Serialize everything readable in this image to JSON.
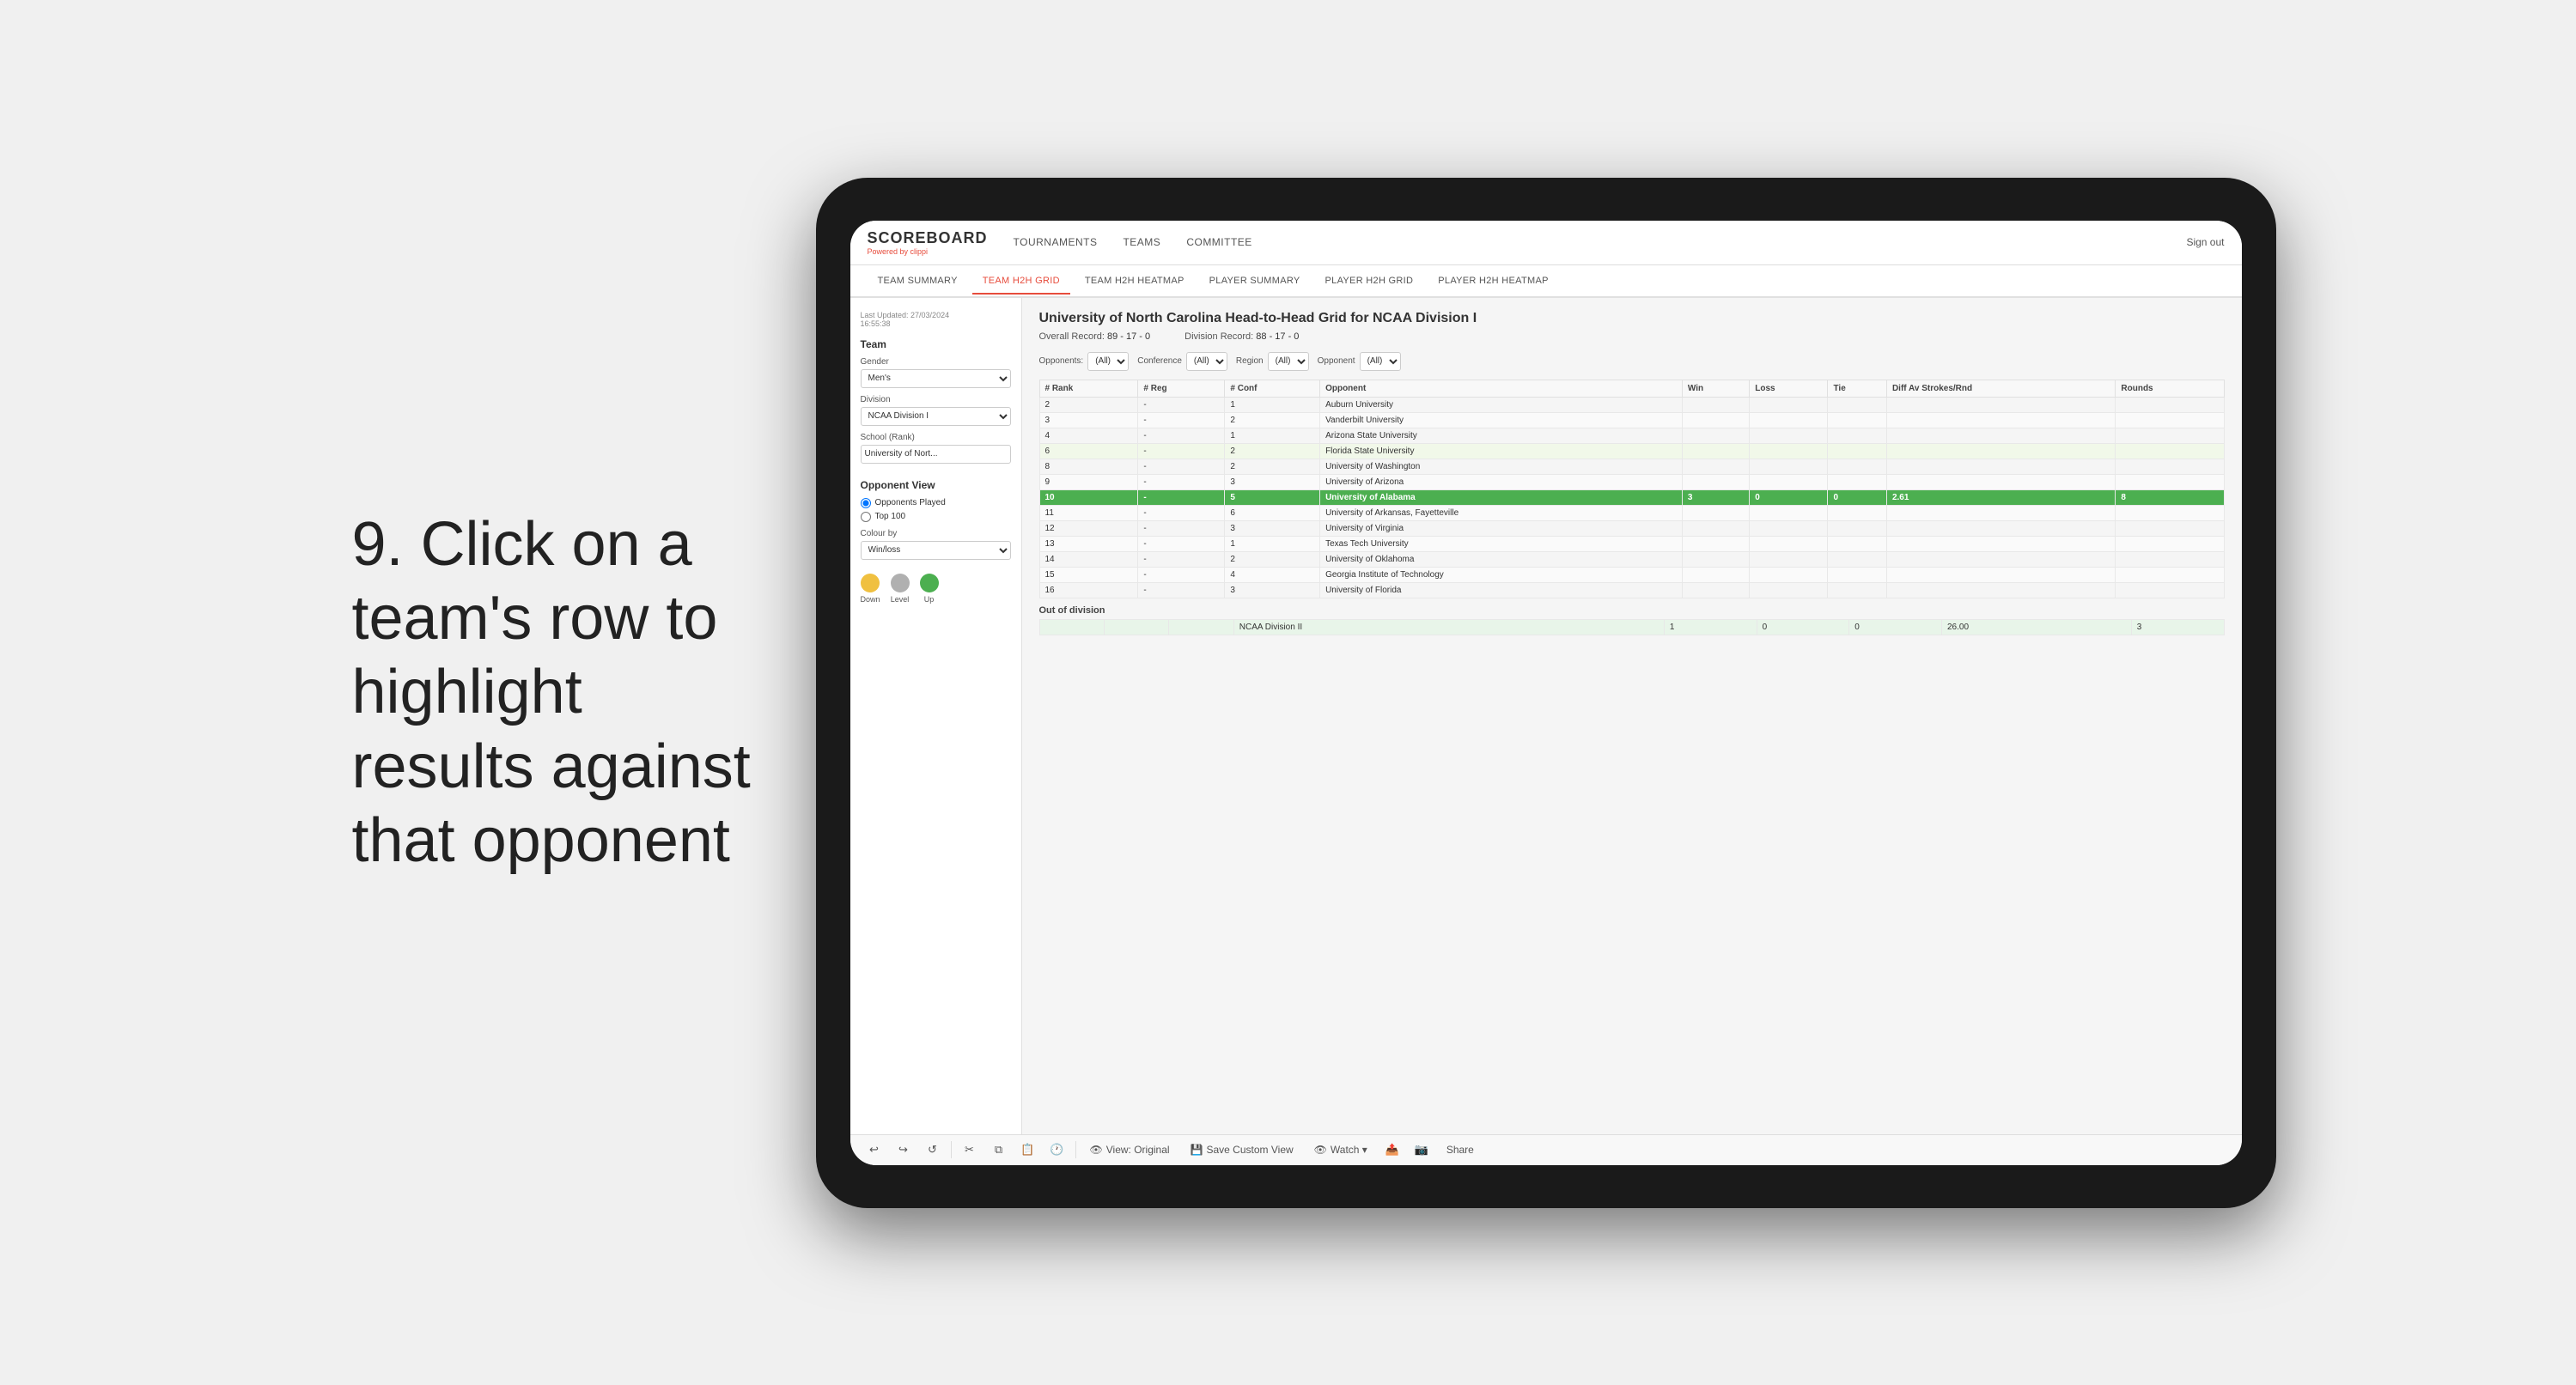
{
  "instruction": {
    "number": "9.",
    "text": "Click on a team's row to highlight results against that opponent"
  },
  "nav": {
    "logo": "SCOREBOARD",
    "powered_by": "Powered by",
    "brand": "clippi",
    "items": [
      "TOURNAMENTS",
      "TEAMS",
      "COMMITTEE"
    ],
    "sign_out": "Sign out"
  },
  "sub_nav": {
    "items": [
      "TEAM SUMMARY",
      "TEAM H2H GRID",
      "TEAM H2H HEATMAP",
      "PLAYER SUMMARY",
      "PLAYER H2H GRID",
      "PLAYER H2H HEATMAP"
    ],
    "active": "TEAM H2H GRID"
  },
  "sidebar": {
    "timestamp_label": "Last Updated: 27/03/2024",
    "time": "16:55:38",
    "team_label": "Team",
    "gender_label": "Gender",
    "gender_value": "Men's",
    "division_label": "Division",
    "division_value": "NCAA Division I",
    "school_label": "School (Rank)",
    "school_value": "University of Nort...",
    "opponent_view_label": "Opponent View",
    "radio_opponents": "Opponents Played",
    "radio_top100": "Top 100",
    "colour_by_label": "Colour by",
    "colour_by_value": "Win/loss",
    "legend_down": "Down",
    "legend_level": "Level",
    "legend_up": "Up"
  },
  "grid": {
    "title": "University of North Carolina Head-to-Head Grid for NCAA Division I",
    "overall_record_label": "Overall Record:",
    "overall_record": "89 - 17 - 0",
    "division_record_label": "Division Record:",
    "division_record": "88 - 17 - 0",
    "filters": {
      "opponents_label": "Opponents:",
      "opponents_value": "(All)",
      "conference_label": "Conference",
      "conference_value": "(All)",
      "region_label": "Region",
      "region_value": "(All)",
      "opponent_label": "Opponent",
      "opponent_value": "(All)"
    },
    "columns": [
      "# Rank",
      "# Reg",
      "# Conf",
      "Opponent",
      "Win",
      "Loss",
      "Tie",
      "Diff Av Strokes/Rnd",
      "Rounds"
    ],
    "rows": [
      {
        "rank": "2",
        "reg": "-",
        "conf": "1",
        "opponent": "Auburn University",
        "win": "",
        "loss": "",
        "tie": "",
        "diff": "",
        "rounds": "",
        "color": ""
      },
      {
        "rank": "3",
        "reg": "-",
        "conf": "2",
        "opponent": "Vanderbilt University",
        "win": "",
        "loss": "",
        "tie": "",
        "diff": "",
        "rounds": "",
        "color": ""
      },
      {
        "rank": "4",
        "reg": "-",
        "conf": "1",
        "opponent": "Arizona State University",
        "win": "",
        "loss": "",
        "tie": "",
        "diff": "",
        "rounds": "",
        "color": ""
      },
      {
        "rank": "6",
        "reg": "-",
        "conf": "2",
        "opponent": "Florida State University",
        "win": "",
        "loss": "",
        "tie": "",
        "diff": "",
        "rounds": "",
        "color": "light"
      },
      {
        "rank": "8",
        "reg": "-",
        "conf": "2",
        "opponent": "University of Washington",
        "win": "",
        "loss": "",
        "tie": "",
        "diff": "",
        "rounds": "",
        "color": ""
      },
      {
        "rank": "9",
        "reg": "-",
        "conf": "3",
        "opponent": "University of Arizona",
        "win": "",
        "loss": "",
        "tie": "",
        "diff": "",
        "rounds": "",
        "color": ""
      },
      {
        "rank": "10",
        "reg": "-",
        "conf": "5",
        "opponent": "University of Alabama",
        "win": "3",
        "loss": "0",
        "tie": "0",
        "diff": "2.61",
        "rounds": "8",
        "color": "highlighted"
      },
      {
        "rank": "11",
        "reg": "-",
        "conf": "6",
        "opponent": "University of Arkansas, Fayetteville",
        "win": "",
        "loss": "",
        "tie": "",
        "diff": "",
        "rounds": "",
        "color": ""
      },
      {
        "rank": "12",
        "reg": "-",
        "conf": "3",
        "opponent": "University of Virginia",
        "win": "",
        "loss": "",
        "tie": "",
        "diff": "",
        "rounds": "",
        "color": ""
      },
      {
        "rank": "13",
        "reg": "-",
        "conf": "1",
        "opponent": "Texas Tech University",
        "win": "",
        "loss": "",
        "tie": "",
        "diff": "",
        "rounds": "",
        "color": ""
      },
      {
        "rank": "14",
        "reg": "-",
        "conf": "2",
        "opponent": "University of Oklahoma",
        "win": "",
        "loss": "",
        "tie": "",
        "diff": "",
        "rounds": "",
        "color": ""
      },
      {
        "rank": "15",
        "reg": "-",
        "conf": "4",
        "opponent": "Georgia Institute of Technology",
        "win": "",
        "loss": "",
        "tie": "",
        "diff": "",
        "rounds": "",
        "color": ""
      },
      {
        "rank": "16",
        "reg": "-",
        "conf": "3",
        "opponent": "University of Florida",
        "win": "",
        "loss": "",
        "tie": "",
        "diff": "",
        "rounds": "",
        "color": ""
      }
    ],
    "out_of_division_label": "Out of division",
    "out_of_division_row": {
      "division": "NCAA Division II",
      "win": "1",
      "loss": "0",
      "tie": "0",
      "diff": "26.00",
      "rounds": "3"
    }
  },
  "toolbar": {
    "undo": "↩",
    "redo": "↪",
    "view_original": "View: Original",
    "save_custom": "Save Custom View",
    "watch": "Watch ▾",
    "share": "Share"
  }
}
